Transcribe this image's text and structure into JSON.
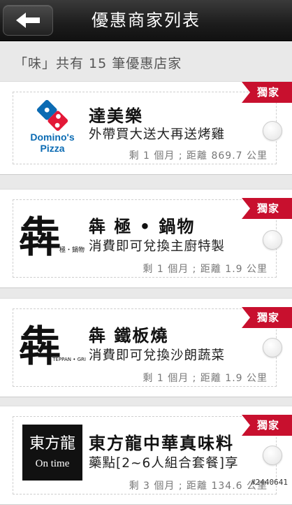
{
  "header": {
    "title": "優惠商家列表"
  },
  "summary": "「味」共有 15 筆優惠店家",
  "badge_label": "獨家",
  "colors": {
    "badge": "#c8102e",
    "topbar": "#1c1c1c"
  },
  "stores": [
    {
      "name": "達美樂",
      "promo": "外帶買大送大再送烤雞",
      "meta": "剩 1 個月 ; 距離 869.7 公里",
      "logo": "dominos-pizza-logo",
      "logo_text_1": "Domino's",
      "logo_text_2": "Pizza"
    },
    {
      "name": "犇 極 • 鍋物",
      "promo": "消費即可兌換主廚特製",
      "meta": "剩 1 個月 ; 距離 1.9 公里",
      "logo": "ben-ji-hotpot-logo",
      "logo_text_1": "犇",
      "logo_text_2": "極・鍋物"
    },
    {
      "name": "犇 鐵板燒",
      "promo": "消費即可兌換沙朗蔬菜",
      "meta": "剩 1 個月 ; 距離 1.9 公里",
      "logo": "ben-teppanyaki-logo",
      "logo_text_1": "犇",
      "logo_text_2": "TEPPAN • GRILL"
    },
    {
      "name": "東方龍中華真味料",
      "promo": "藥點[2~6人組合套餐]享",
      "meta": "剩 3 個月 ; 距離 134.6 公里",
      "logo": "on-time-restaurant-logo",
      "logo_text_1": "東方龍",
      "logo_text_2": "On time"
    }
  ],
  "watermark": "#2440641"
}
